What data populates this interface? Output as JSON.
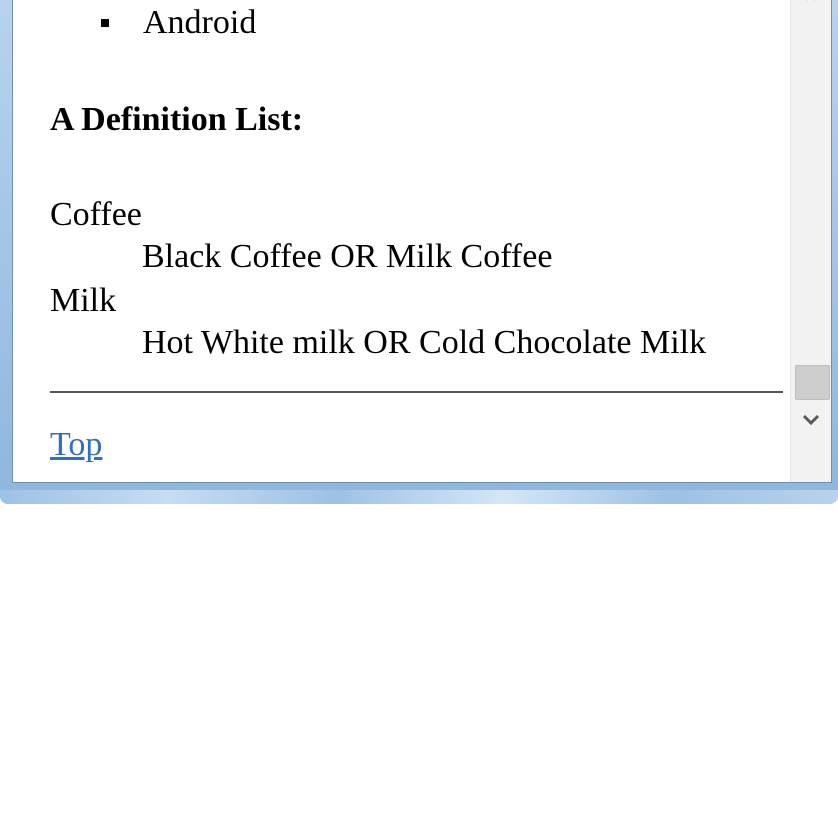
{
  "list": {
    "items": [
      "Android"
    ]
  },
  "heading": "A Definition List:",
  "definitions": [
    {
      "term": "Coffee",
      "description": "Black Coffee OR Milk Coffee"
    },
    {
      "term": "Milk",
      "description": "Hot White milk OR Cold Chocolate Milk"
    }
  ],
  "links": {
    "top": "Top"
  },
  "scrollbar": {
    "up_icon": "chevron-up-icon",
    "down_icon": "chevron-down-icon",
    "position": 0.9
  }
}
